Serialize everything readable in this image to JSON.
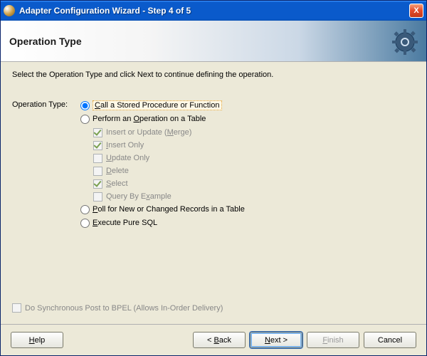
{
  "window": {
    "title": "Adapter Configuration Wizard - Step 4 of 5",
    "close_glyph": "X"
  },
  "header": {
    "title": "Operation Type"
  },
  "intro": "Select the Operation Type and click Next to continue defining the operation.",
  "form": {
    "label": "Operation Type:",
    "radios": {
      "stored_proc_pre": "",
      "stored_proc_accel": "C",
      "stored_proc_post": "all a Stored Procedure or Function",
      "table_op_pre": "Perform an ",
      "table_op_accel": "O",
      "table_op_post": "peration on a Table",
      "poll_pre": "",
      "poll_accel": "P",
      "poll_post": "oll for New or Changed Records in a Table",
      "pure_sql_pre": "",
      "pure_sql_accel": "E",
      "pure_sql_post": "xecute Pure SQL"
    },
    "subs": {
      "merge_pre": "Insert or Update (",
      "merge_accel": "M",
      "merge_post": "erge)",
      "insert_pre": "",
      "insert_accel": "I",
      "insert_post": "nsert Only",
      "update_pre": "",
      "update_accel": "U",
      "update_post": "pdate Only",
      "delete_pre": "",
      "delete_accel": "D",
      "delete_post": "elete",
      "select_pre": "",
      "select_accel": "S",
      "select_post": "elect",
      "qbe_pre": "Query By E",
      "qbe_accel": "x",
      "qbe_post": "ample"
    }
  },
  "sync": {
    "label": "Do Synchronous Post to BPEL (Allows In-Order Delivery)"
  },
  "footer": {
    "help_pre": "",
    "help_accel": "H",
    "help_post": "elp",
    "back_pre": "< ",
    "back_accel": "B",
    "back_post": "ack",
    "next_pre": "",
    "next_accel": "N",
    "next_post": "ext >",
    "finish_pre": "",
    "finish_accel": "F",
    "finish_post": "inish",
    "cancel": "Cancel"
  }
}
